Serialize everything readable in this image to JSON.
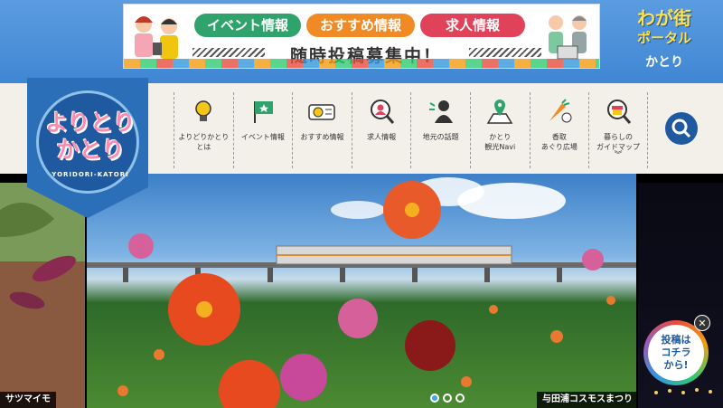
{
  "banner": {
    "pill1": "イベント情報",
    "pill2": "おすすめ情報",
    "pill3": "求人情報",
    "headline": "随時投稿募集中！"
  },
  "portal": {
    "line1": "わが街",
    "line2": "ポータル",
    "line3": "かとり"
  },
  "logo": {
    "line1": "よりとり",
    "line2": "かとり",
    "sub": "YORIDORI-KATORI"
  },
  "nav": {
    "items": [
      {
        "label1": "よりどりかとり",
        "label2": "とは",
        "icon": "lightbulb-icon"
      },
      {
        "label1": "イベント情報",
        "label2": "",
        "icon": "flag-icon"
      },
      {
        "label1": "おすすめ情報",
        "label2": "",
        "icon": "ticket-icon"
      },
      {
        "label1": "求人情報",
        "label2": "",
        "icon": "job-search-icon"
      },
      {
        "label1": "地元の話題",
        "label2": "",
        "icon": "speaker-icon"
      },
      {
        "label1": "かとり",
        "label2": "観光Navi",
        "icon": "map-pin-icon"
      },
      {
        "label1": "香取",
        "label2": "あぐり広場",
        "icon": "vegetable-icon"
      },
      {
        "label1": "暮らしの",
        "label2": "ガイドマップ",
        "icon": "shop-map-icon"
      }
    ]
  },
  "hero": {
    "left_caption": "サツマイモ",
    "right_caption": "与田浦コスモスまつり"
  },
  "post_badge": {
    "line1": "投稿は",
    "line2": "コチラ",
    "line3": "から!"
  },
  "colors": {
    "brand_blue": "#1f5aa0",
    "top_blue": "#4a8fd6",
    "accent_green": "#2fa36b",
    "accent_orange": "#f08a24",
    "accent_red": "#e0425a"
  }
}
